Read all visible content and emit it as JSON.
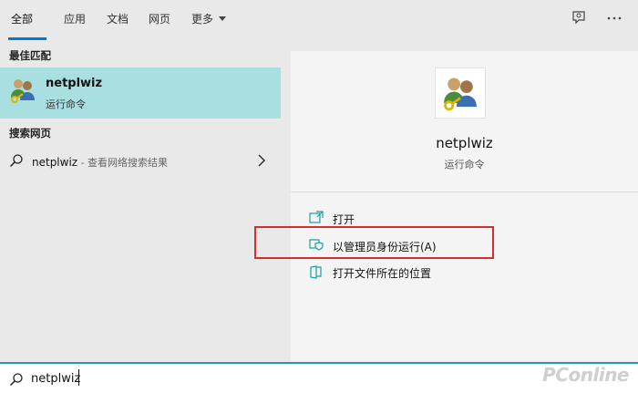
{
  "tabs": [
    {
      "label": "全部",
      "active": true
    },
    {
      "label": "应用",
      "active": false
    },
    {
      "label": "文档",
      "active": false
    },
    {
      "label": "网页",
      "active": false
    },
    {
      "label": "更多",
      "active": false
    }
  ],
  "top_icons": [
    "feedback-icon",
    "more-options-icon"
  ],
  "left": {
    "best_match_heading": "最佳匹配",
    "best_match": {
      "title": "netplwiz",
      "subtitle": "运行命令",
      "icon": "users-key-icon"
    },
    "web_heading": "搜索网页",
    "web_result": {
      "query": "netplwiz",
      "suffix": " - 查看网络搜索结果"
    }
  },
  "detail": {
    "title": "netplwiz",
    "subtitle": "运行命令",
    "actions": [
      {
        "label": "打开",
        "icon": "open-icon"
      },
      {
        "label": "以管理员身份运行(A)",
        "icon": "shield-icon",
        "highlighted": true
      },
      {
        "label": "打开文件所在的位置",
        "icon": "folder-location-icon"
      }
    ]
  },
  "search": {
    "value": "netplwiz"
  },
  "watermark": "PConline",
  "colors": {
    "accent": "#0078d7",
    "selection": "#a8dfe1",
    "highlight_border": "#d32f2f",
    "search_border": "#1e9fa3"
  }
}
